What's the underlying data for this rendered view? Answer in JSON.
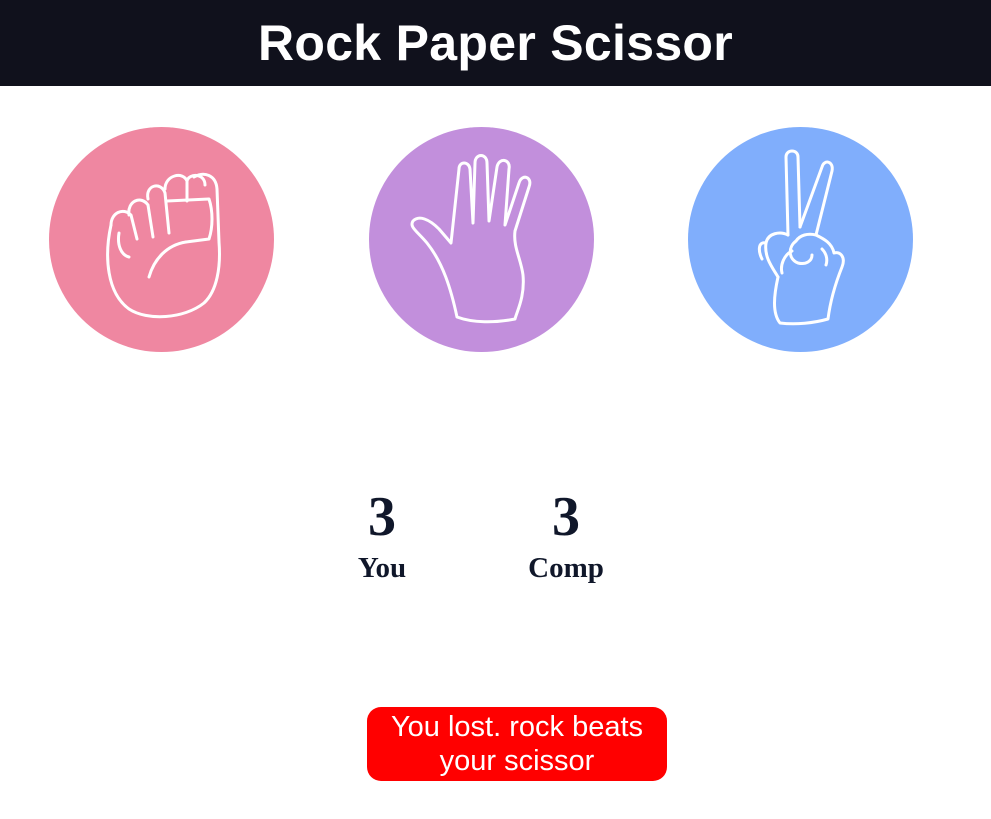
{
  "header": {
    "title": "Rock Paper Scissor"
  },
  "choices": [
    {
      "id": "rock",
      "icon": "fist-icon",
      "color": "#ef87a1"
    },
    {
      "id": "paper",
      "icon": "open-hand-icon",
      "color": "#c28fdc"
    },
    {
      "id": "scissors",
      "icon": "peace-hand-icon",
      "color": "#80aefc"
    }
  ],
  "scoreboard": {
    "user": {
      "score": "3",
      "label": "You"
    },
    "comp": {
      "score": "3",
      "label": "Comp"
    }
  },
  "message": {
    "text": "You lost. rock beats your scissor",
    "color": "#ff0000"
  }
}
